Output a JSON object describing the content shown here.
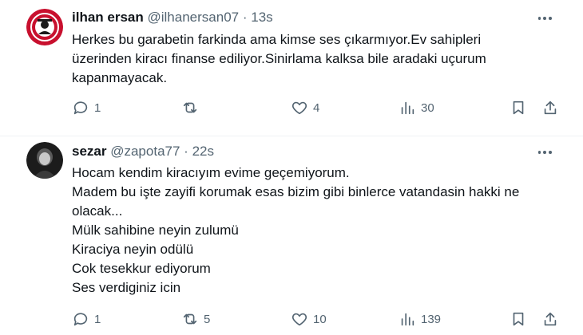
{
  "tweets": [
    {
      "name": "ilhan ersan",
      "handle": "@ilhanersan07",
      "dot": "·",
      "time": "13s",
      "lines": [
        "Herkes bu garabetin farkinda ama kimse ses çıkarmıyor.Ev sahipleri",
        "üzerinden kiracı finanse ediliyor.Sinirlama kalksa bile aradaki uçurum",
        "kapanmayacak."
      ],
      "replies": "1",
      "retweets": "",
      "likes": "4",
      "views": "30",
      "avatar_colors": {
        "bg": "#c8102e",
        "ring": "#ffffff",
        "inner": "#1a1a1a"
      }
    },
    {
      "name": "sezar",
      "handle": "@zapota77",
      "dot": "·",
      "time": "22s",
      "lines": [
        "Hocam kendim kiracıyım evime geçemiyorum.",
        "Madem bu işte zayifi korumak esas bizim gibi binlerce vatandasin hakki ne",
        "olacak...",
        "Mülk sahibine neyin zulumü",
        "Kiraciya neyin odülü",
        "Cok tesekkur ediyorum",
        "Ses verdiginiz icin"
      ],
      "replies": "1",
      "retweets": "5",
      "likes": "10",
      "views": "139",
      "avatar_colors": {
        "bg": "#1c1c1c",
        "ring": "#5a5a5a",
        "inner": "#c9c9c9"
      }
    }
  ],
  "colors": {
    "text": "#0f1419",
    "muted": "#536471",
    "divider": "#eff3f4"
  },
  "icons": [
    "reply-icon",
    "retweet-icon",
    "like-icon",
    "views-icon",
    "bookmark-icon",
    "share-icon",
    "more-icon"
  ]
}
